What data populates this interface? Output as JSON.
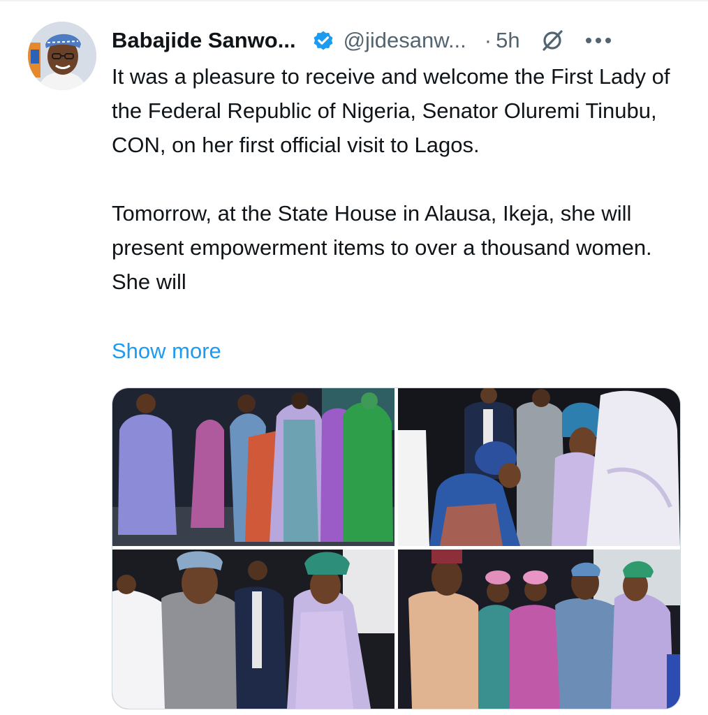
{
  "post": {
    "author_name": "Babajide Sanwo...",
    "handle": "@jidesanw...",
    "separator": "·",
    "time": "5h",
    "text_paragraphs": [
      "It was a pleasure to receive and welcome the First Lady of the Federal Republic of Nigeria, Senator Oluremi Tinubu, CON, on her first official visit to Lagos.",
      "Tomorrow, at the State House in Alausa, Ikeja, she will present empowerment items to over a thousand women. She will"
    ],
    "show_more": "Show more"
  },
  "icons": {
    "verified": "verified-badge-icon",
    "grok": "grok-icon",
    "more": "more-options-icon"
  },
  "colors": {
    "verified_blue": "#1d9bf0",
    "link_blue": "#1d9bf0",
    "secondary_text": "#536471"
  },
  "media": {
    "photo_count": 4
  }
}
